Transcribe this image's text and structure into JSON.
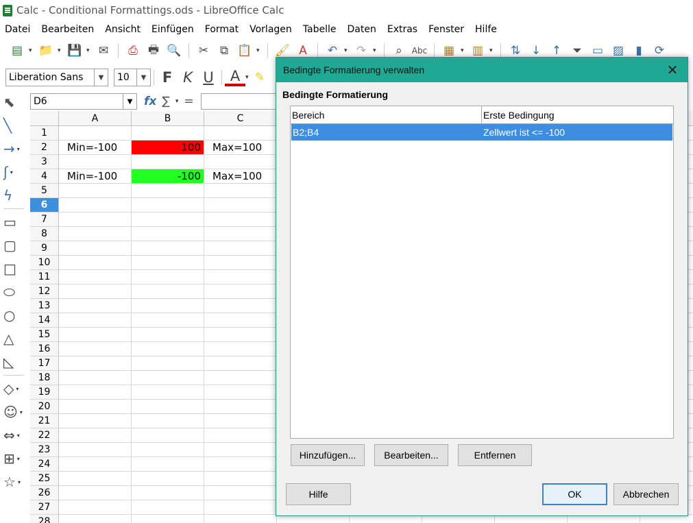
{
  "window": {
    "title": "Calc - Conditional Formattings.ods - LibreOffice Calc"
  },
  "menu": [
    "Datei",
    "Bearbeiten",
    "Ansicht",
    "Einfügen",
    "Format",
    "Vorlagen",
    "Tabelle",
    "Daten",
    "Extras",
    "Fenster",
    "Hilfe"
  ],
  "format_toolbar": {
    "font_name": "Liberation Sans",
    "font_size": "10",
    "bold_label": "F",
    "italic_label": "K",
    "underline_label": "U",
    "font_color_label": "A"
  },
  "formula_bar": {
    "cell_ref": "D6",
    "fx_label": "fx",
    "sum_label": "∑",
    "equals_label": "="
  },
  "sheet": {
    "columns": [
      "A",
      "B",
      "C"
    ],
    "active_row": 6,
    "rows": [
      {
        "n": "1",
        "a": "",
        "b": "",
        "c": ""
      },
      {
        "n": "2",
        "a": "Min=-100",
        "b": "100",
        "c": "Max=100"
      },
      {
        "n": "3",
        "a": "",
        "b": "",
        "c": ""
      },
      {
        "n": "4",
        "a": "Min=-100",
        "b": "-100",
        "c": "Max=100"
      },
      {
        "n": "5",
        "a": "",
        "b": "",
        "c": ""
      },
      {
        "n": "6",
        "a": "",
        "b": "",
        "c": ""
      },
      {
        "n": "7",
        "a": "",
        "b": "",
        "c": ""
      },
      {
        "n": "8",
        "a": "",
        "b": "",
        "c": ""
      },
      {
        "n": "9",
        "a": "",
        "b": "",
        "c": ""
      },
      {
        "n": "10",
        "a": "",
        "b": "",
        "c": ""
      },
      {
        "n": "11",
        "a": "",
        "b": "",
        "c": ""
      },
      {
        "n": "12",
        "a": "",
        "b": "",
        "c": ""
      },
      {
        "n": "13",
        "a": "",
        "b": "",
        "c": ""
      },
      {
        "n": "14",
        "a": "",
        "b": "",
        "c": ""
      },
      {
        "n": "15",
        "a": "",
        "b": "",
        "c": ""
      },
      {
        "n": "16",
        "a": "",
        "b": "",
        "c": ""
      },
      {
        "n": "17",
        "a": "",
        "b": "",
        "c": ""
      },
      {
        "n": "18",
        "a": "",
        "b": "",
        "c": ""
      },
      {
        "n": "19",
        "a": "",
        "b": "",
        "c": ""
      },
      {
        "n": "20",
        "a": "",
        "b": "",
        "c": ""
      },
      {
        "n": "21",
        "a": "",
        "b": "",
        "c": ""
      },
      {
        "n": "22",
        "a": "",
        "b": "",
        "c": ""
      },
      {
        "n": "23",
        "a": "",
        "b": "",
        "c": ""
      },
      {
        "n": "24",
        "a": "",
        "b": "",
        "c": ""
      },
      {
        "n": "25",
        "a": "",
        "b": "",
        "c": ""
      },
      {
        "n": "26",
        "a": "",
        "b": "",
        "c": ""
      },
      {
        "n": "27",
        "a": "",
        "b": "",
        "c": ""
      },
      {
        "n": "28",
        "a": "",
        "b": "",
        "c": ""
      }
    ],
    "cell_colors": {
      "B2": "#ff0000",
      "B4": "#22ff22"
    }
  },
  "dialog": {
    "title": "Bedingte Formatierung verwalten",
    "heading": "Bedingte Formatierung",
    "table_headers": [
      "Bereich",
      "Erste Bedingung"
    ],
    "rows": [
      {
        "range": "B2;B4",
        "condition": "Zellwert ist <= -100"
      }
    ],
    "buttons": {
      "add": "Hinzufügen...",
      "edit": "Bearbeiten...",
      "remove": "Entfernen",
      "help": "Hilfe",
      "ok": "OK",
      "cancel": "Abbrechen"
    },
    "accent_color": "#20a894",
    "selection_color": "#3d8ee0"
  }
}
